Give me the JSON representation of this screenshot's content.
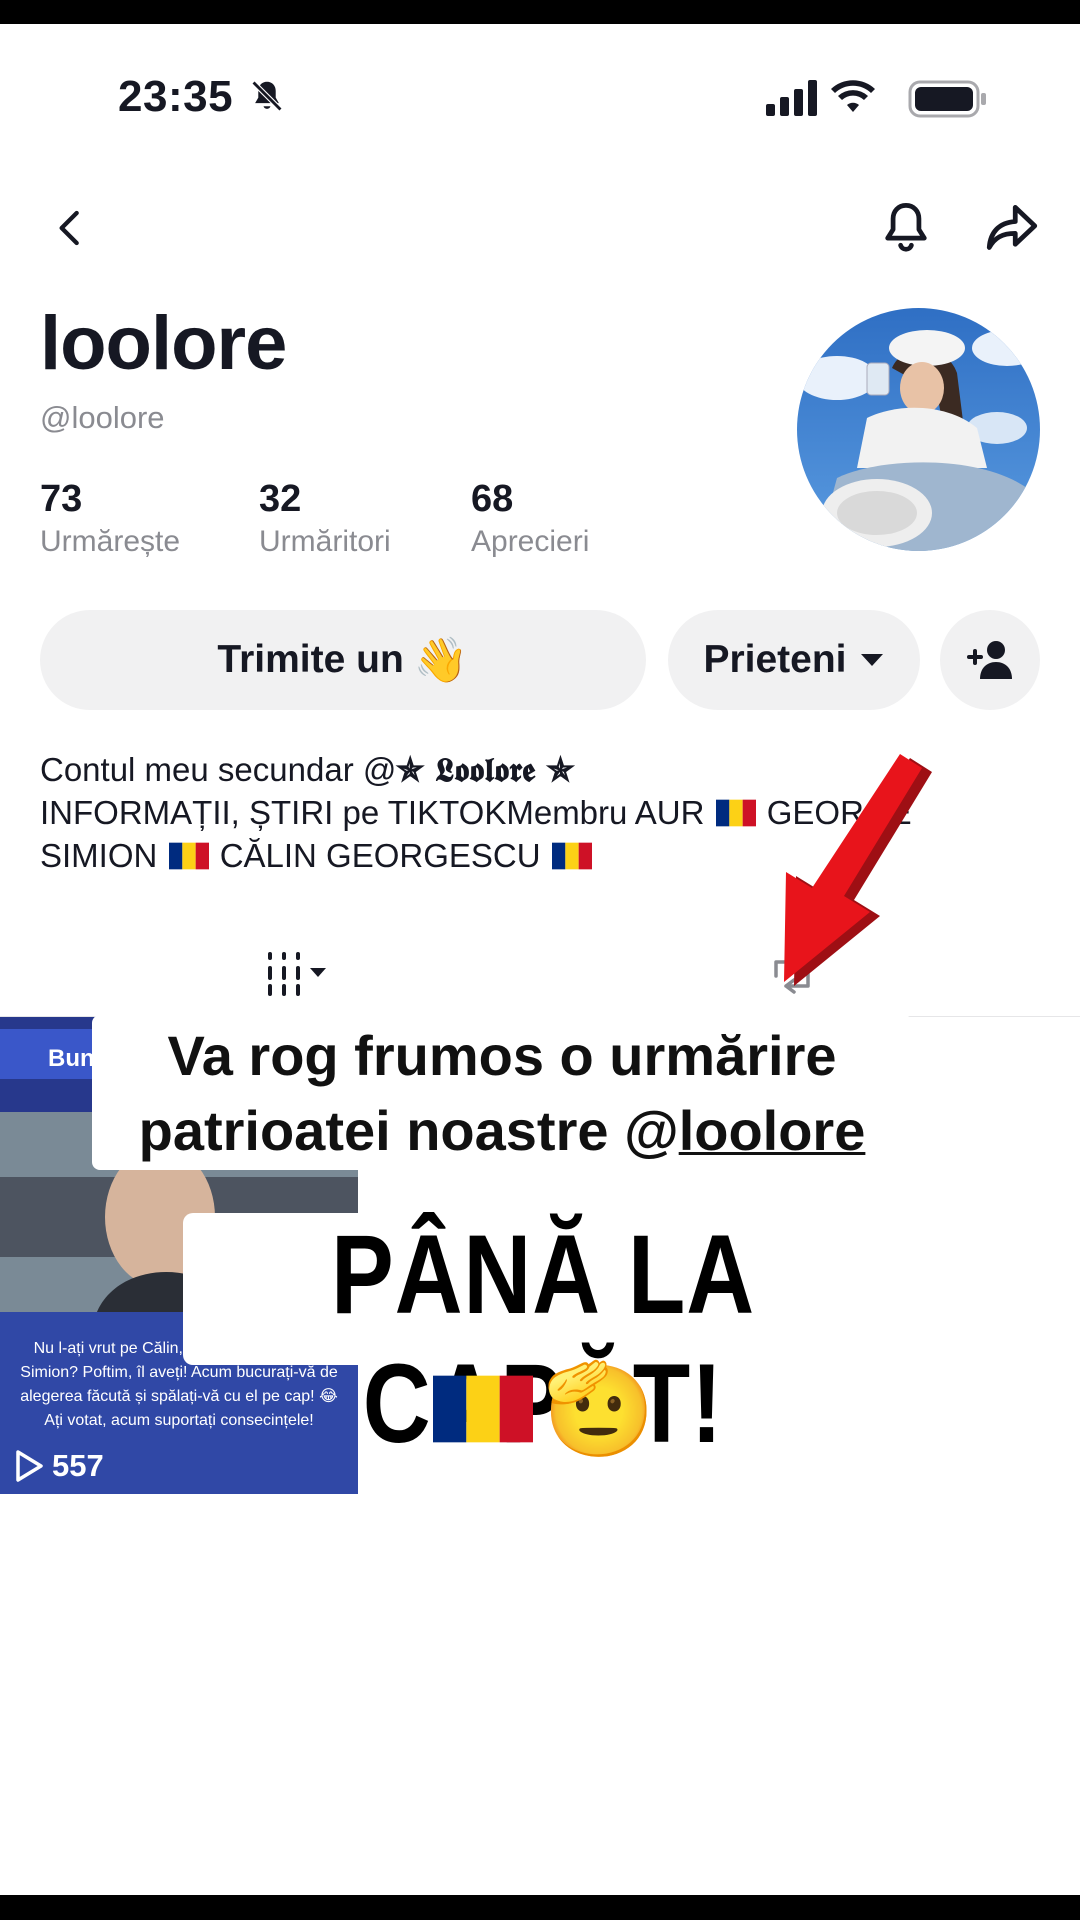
{
  "status_bar": {
    "time": "23:35"
  },
  "profile": {
    "name": "loolore",
    "handle": "@loolore",
    "stats": [
      {
        "value": "73",
        "label": "Urmărește"
      },
      {
        "value": "32",
        "label": "Urmăritori"
      },
      {
        "value": "68",
        "label": "Aprecieri"
      }
    ]
  },
  "actions": {
    "wave_label": "Trimite un",
    "wave_emoji": "👋",
    "friends_label": "Prieteni"
  },
  "bio": {
    "line1_text": "Contul meu secundar @",
    "line1_fancy": "✯ 𝕷𝖔𝖔𝖑𝖔𝖗𝖊 ✯",
    "line2_a": "INFORMAȚII, ȘTIRI pe TIKTOKMembru AUR",
    "line2_b": "GEORGE",
    "line3_a": "SIMION",
    "line3_b": "CĂLIN GEORGESCU"
  },
  "video": {
    "views": "557",
    "caption": "Nu l-ați vrut pe Călin, l-ați vrut pe George Simion? Poftim, îl aveți! Acum bucurați-vă de alegerea făcută și spălați-vă cu el pe cap! 😂 Ați votat, acum suportați consecințele!",
    "top_text": "Bun"
  },
  "overlay": {
    "line1": "Va rog frumos o urmărire",
    "line2_prefix": "patrioatei noastre @",
    "line2_link": "loolore",
    "headline": "PÂNĂ LA CAPĂT!",
    "salute_emoji": "🫡"
  },
  "colors": {
    "accent_red": "#e8141b",
    "flag_blue": "#002b7f",
    "flag_yellow": "#fcd116",
    "flag_red": "#ce1126"
  }
}
